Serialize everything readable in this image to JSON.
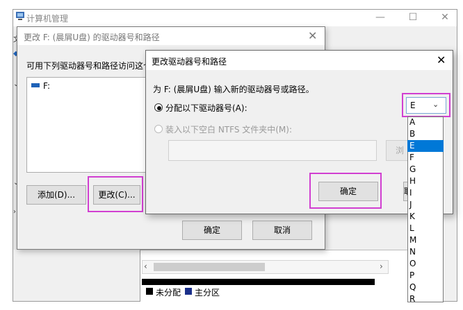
{
  "main_window": {
    "title": "计算机管理",
    "controls": {
      "minimize": "—",
      "maximize": "☐",
      "close": "✕"
    },
    "left_glyphs": [
      "文",
      "◆",
      "⌄",
      "⌄",
      "›"
    ],
    "legend": {
      "unallocated": "未分配",
      "primary": "主分区",
      "unallocated_color": "#000000",
      "primary_color": "#1a2f8a"
    },
    "scroll_left": "‹",
    "scroll_right": "›"
  },
  "change_dialog": {
    "title": "更改 F: (晨屑U盘) 的驱动器号和路径",
    "close": "✕",
    "description": "可用下列驱动器号和路径访问这个",
    "list_item": "F:",
    "add_button": "添加(D)...",
    "change_button": "更改(C)...",
    "ok_button": "确定",
    "cancel_button": "取消"
  },
  "assign_dialog": {
    "title": "更改驱动器号和路径",
    "close": "✕",
    "prompt": "为 F: (晨屑U盘) 输入新的驱动器号或路径。",
    "option_assign": "分配以下驱动器号(A):",
    "option_mount": "装入以下空白 NTFS 文件夹中(M):",
    "browse_button": "浏",
    "ok_button": "确定",
    "cancel_button": "取",
    "drive_letter": {
      "selected": "E",
      "arrow": "⌄"
    },
    "letters": [
      "A",
      "B",
      "E",
      "F",
      "G",
      "H",
      "I",
      "J",
      "K",
      "L",
      "M",
      "N",
      "O",
      "P",
      "Q",
      "R"
    ],
    "selected_index": 2
  },
  "colors": {
    "highlight": "#d13fd1",
    "selection": "#0078d7"
  }
}
